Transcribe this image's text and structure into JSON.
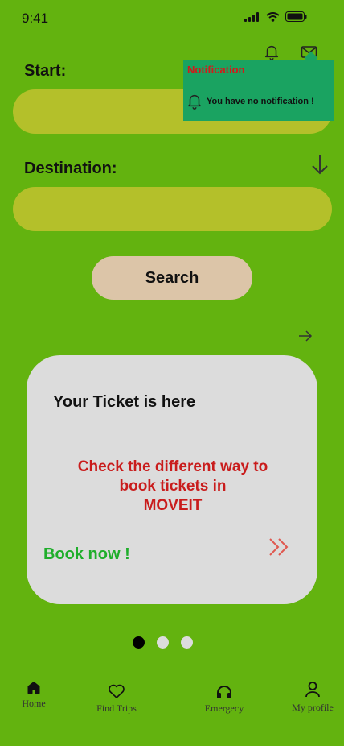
{
  "status": {
    "time": "9:41"
  },
  "form": {
    "start_label": "Start:",
    "start_value": "",
    "destination_label": "Destination:",
    "destination_value": "",
    "search_label": "Search"
  },
  "notification": {
    "title": "Notification",
    "message": "You have no notification !"
  },
  "card": {
    "title": "Your Ticket is here",
    "line1": "Check the different way to",
    "line2": "book tickets in",
    "line3": "MOVEIT",
    "cta": "Book now !"
  },
  "carousel": {
    "pages": 3,
    "active": 1
  },
  "nav": {
    "home": "Home",
    "find_trips": "Find Trips",
    "emergency": "Emergecy",
    "profile": "My profile"
  },
  "colors": {
    "background": "#63b30f",
    "input": "#b4c02a",
    "button": "#dcc5a8",
    "card": "#dcdcdc",
    "accent_red": "#c91c1c",
    "accent_green": "#1fae2b",
    "notification": "#1aa361"
  },
  "icons": [
    "signal-icon",
    "wifi-icon",
    "battery-icon",
    "bell-icon",
    "mail-icon",
    "arrow-down-icon",
    "arrow-right-icon",
    "double-chevron-icon",
    "home-icon",
    "heart-icon",
    "headphones-icon",
    "user-icon"
  ]
}
